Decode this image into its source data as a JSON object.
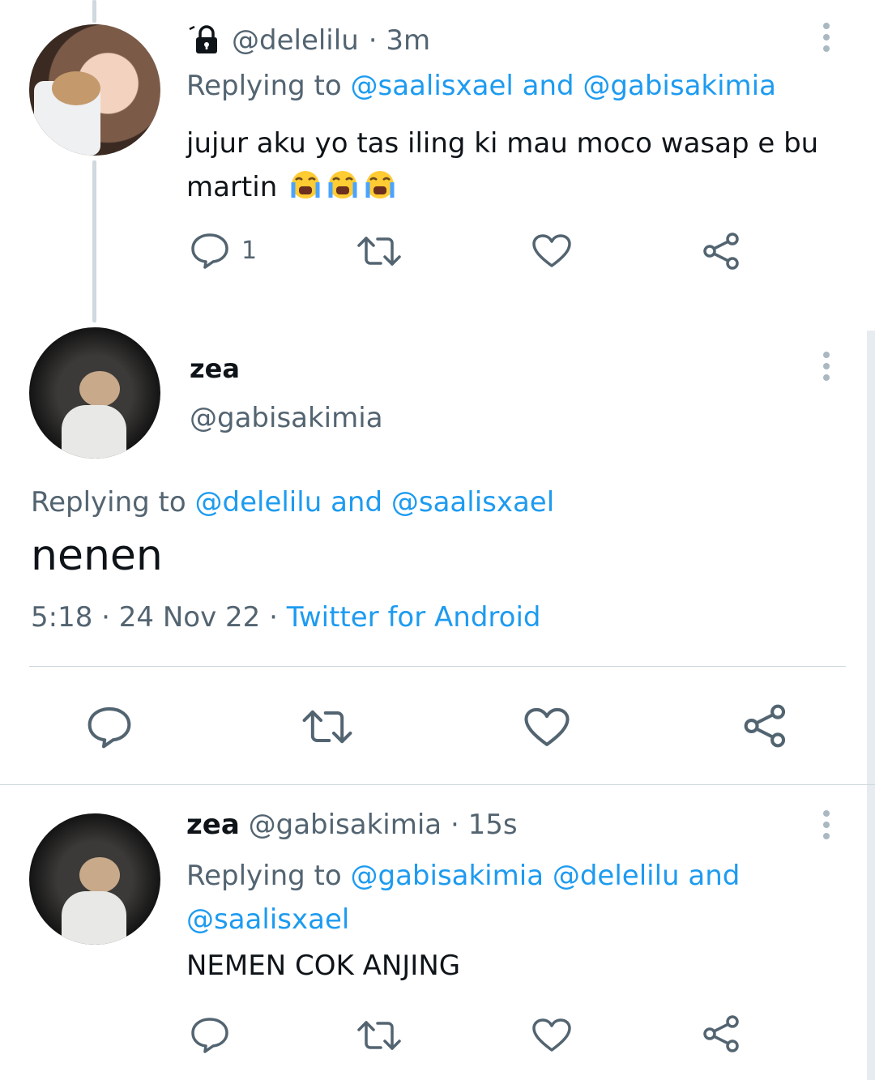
{
  "tweet1": {
    "handle": "@delelilu",
    "time": "· 3m",
    "replying_prefix": "Replying to",
    "mention_1": "@saalisxael",
    "mention_and": "and",
    "mention_2": "@gabisakimia",
    "text_line1": "jujur aku yo tas iling ki mau moco wasap e bu",
    "text_line2": "martin",
    "emojis": "😭😭😭",
    "reply_count": "1",
    "icons": [
      "lock-icon",
      "reply-icon",
      "retweet-icon",
      "like-icon",
      "share-icon",
      "more-icon"
    ]
  },
  "main_tweet": {
    "name": "zea",
    "handle": "@gabisakimia",
    "replying_prefix": "Replying to",
    "mention_1": "@delelilu",
    "mention_and": "and",
    "mention_2": "@saalisxael",
    "text": "nenen",
    "timestamp": "5:18 · 24 Nov 22 · ",
    "source": "Twitter for Android"
  },
  "tweet3": {
    "name": "zea",
    "handle": "@gabisakimia",
    "time": "· 15s",
    "replying_prefix": "Replying to",
    "mention_1": "@gabisakimia",
    "mention_2": "@delelilu",
    "mention_and": "and",
    "mention_3": "@saalisxael",
    "text": "NEMEN COK ANJING"
  },
  "colors": {
    "link": "#1d9bf0",
    "muted": "#536471",
    "text": "#0f1419",
    "divider": "#cfd9de"
  }
}
